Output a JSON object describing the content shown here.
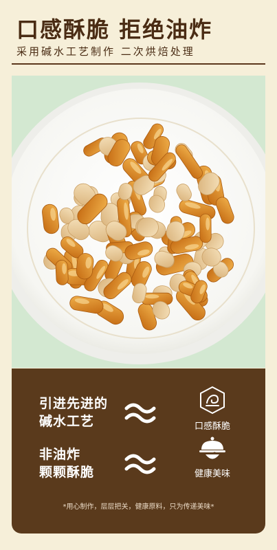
{
  "header": {
    "title": "口感酥脆 拒绝油炸",
    "subtitle": "采用碱水工艺制作 二次烘焙处理"
  },
  "features": {
    "rows": [
      {
        "line1": "引进先进的",
        "line2": "碱水工艺",
        "icon": "crisp-wave-icon",
        "label": "口感酥脆"
      },
      {
        "line1": "非油炸",
        "line2": "颗颗酥脆",
        "icon": "covered-dish-icon",
        "label": "健康美味"
      }
    ],
    "footer_note": "*用心制作，层层把关，健康原料，只为传递美味*"
  },
  "colors": {
    "background": "#f6efd9",
    "text_brown": "#4a2c14",
    "panel_brown": "#5a3a1c",
    "accent_white": "#ffffff"
  }
}
